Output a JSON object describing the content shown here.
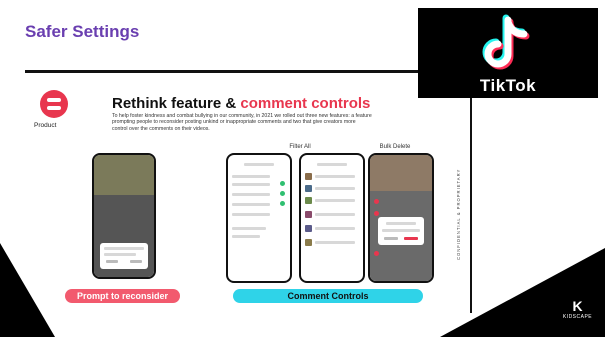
{
  "header": {
    "title": "Safer Settings"
  },
  "logo": {
    "brand": "TikTok",
    "icon": "tiktok-note-icon"
  },
  "footer_logo": {
    "name": "KIDSCAPE",
    "mark": "K"
  },
  "slide": {
    "product_label": "Product",
    "heading_main": "Rethink feature & ",
    "heading_accent": "comment controls",
    "description": "To help foster kindness and combat bullying in our community, in 2021 we rolled out three new features: a feature prompting people to reconsider posting unkind or inappropriate comments and two that give creators more control over the comments on their videos.",
    "caption_filter": "Filter All",
    "caption_bulk": "Bulk Delete",
    "vertical_label": "CONFIDENTIAL & PROPRIETARY",
    "pill_prompt": "Prompt to reconsider",
    "pill_comment": "Comment Controls"
  },
  "colors": {
    "title_purple": "#6a3fb0",
    "accent_red": "#e8364e",
    "pill_red": "#f25a6e",
    "pill_cyan": "#2fd3e8",
    "black": "#000000"
  }
}
